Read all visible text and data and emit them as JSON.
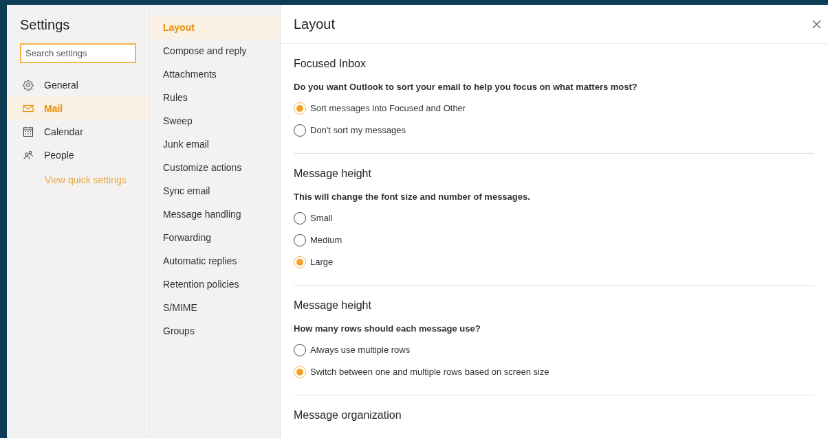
{
  "sidebar": {
    "title": "Settings",
    "search": {
      "placeholder": "Search settings"
    },
    "items": [
      {
        "label": "General",
        "selected": false
      },
      {
        "label": "Mail",
        "selected": true
      },
      {
        "label": "Calendar",
        "selected": false
      },
      {
        "label": "People",
        "selected": false
      }
    ],
    "link": "View quick settings"
  },
  "subnav": [
    {
      "label": "Layout",
      "selected": true
    },
    {
      "label": "Compose and reply",
      "selected": false
    },
    {
      "label": "Attachments",
      "selected": false
    },
    {
      "label": "Rules",
      "selected": false
    },
    {
      "label": "Sweep",
      "selected": false
    },
    {
      "label": "Junk email",
      "selected": false
    },
    {
      "label": "Customize actions",
      "selected": false
    },
    {
      "label": "Sync email",
      "selected": false
    },
    {
      "label": "Message handling",
      "selected": false
    },
    {
      "label": "Forwarding",
      "selected": false
    },
    {
      "label": "Automatic replies",
      "selected": false
    },
    {
      "label": "Retention policies",
      "selected": false
    },
    {
      "label": "S/MIME",
      "selected": false
    },
    {
      "label": "Groups",
      "selected": false
    }
  ],
  "content": {
    "title": "Layout",
    "sections": [
      {
        "title": "Focused Inbox",
        "question": "Do you want Outlook to sort your email to help you focus on what matters most?",
        "options": [
          {
            "label": "Sort messages into Focused and Other",
            "selected": true
          },
          {
            "label": "Don't sort my messages",
            "selected": false
          }
        ]
      },
      {
        "title": "Message height",
        "question": "This will change the font size and number of messages.",
        "options": [
          {
            "label": "Small",
            "selected": false
          },
          {
            "label": "Medium",
            "selected": false
          },
          {
            "label": "Large",
            "selected": true
          }
        ]
      },
      {
        "title": "Message height",
        "question": "How many rows should each message use?",
        "options": [
          {
            "label": "Always use multiple rows",
            "selected": false
          },
          {
            "label": "Switch between one and multiple rows based on screen size",
            "selected": true
          }
        ]
      },
      {
        "title": "Message organization"
      }
    ]
  }
}
